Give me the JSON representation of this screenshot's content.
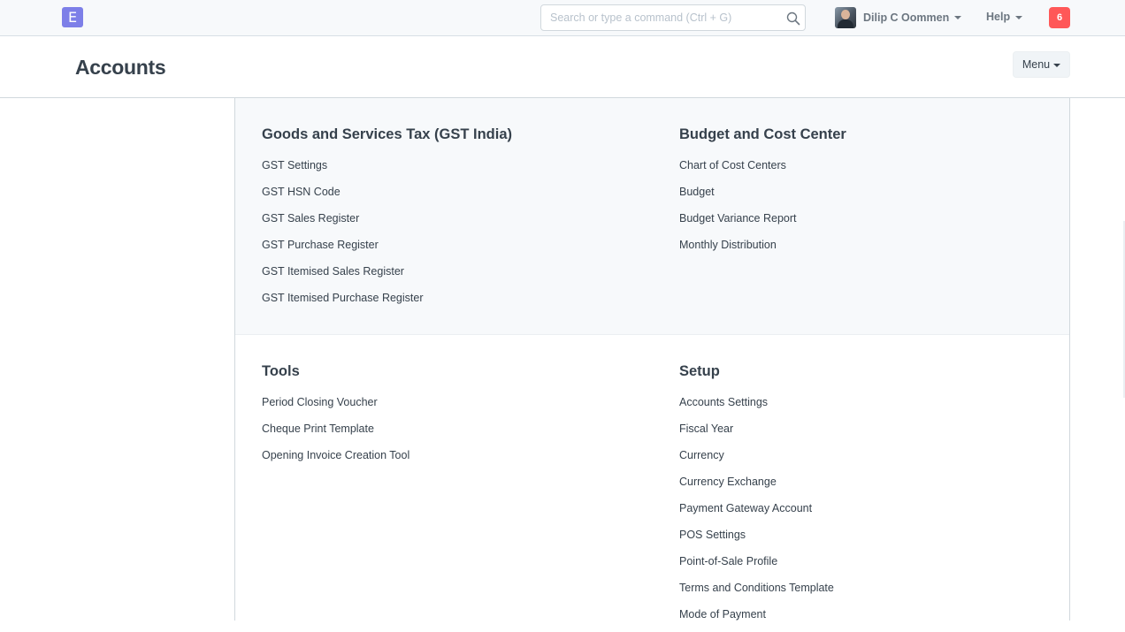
{
  "navbar": {
    "logo_letter": "E",
    "search_placeholder": "Search or type a command (Ctrl + G)",
    "user_name": "Dilip C Oommen",
    "help_label": "Help",
    "notification_count": "6",
    "brand_color": "#7d7fe8",
    "notification_color": "#ff5858"
  },
  "page": {
    "title": "Accounts",
    "menu_label": "Menu"
  },
  "sections": [
    {
      "columns": [
        {
          "title": "Goods and Services Tax (GST India)",
          "links": [
            "GST Settings",
            "GST HSN Code",
            "GST Sales Register",
            "GST Purchase Register",
            "GST Itemised Sales Register",
            "GST Itemised Purchase Register"
          ]
        },
        {
          "title": "Budget and Cost Center",
          "links": [
            "Chart of Cost Centers",
            "Budget",
            "Budget Variance Report",
            "Monthly Distribution"
          ]
        }
      ]
    },
    {
      "columns": [
        {
          "title": "Tools",
          "links": [
            "Period Closing Voucher",
            "Cheque Print Template",
            "Opening Invoice Creation Tool"
          ]
        },
        {
          "title": "Setup",
          "links": [
            "Accounts Settings",
            "Fiscal Year",
            "Currency",
            "Currency Exchange",
            "Payment Gateway Account",
            "POS Settings",
            "Point-of-Sale Profile",
            "Terms and Conditions Template",
            "Mode of Payment"
          ]
        }
      ]
    }
  ]
}
